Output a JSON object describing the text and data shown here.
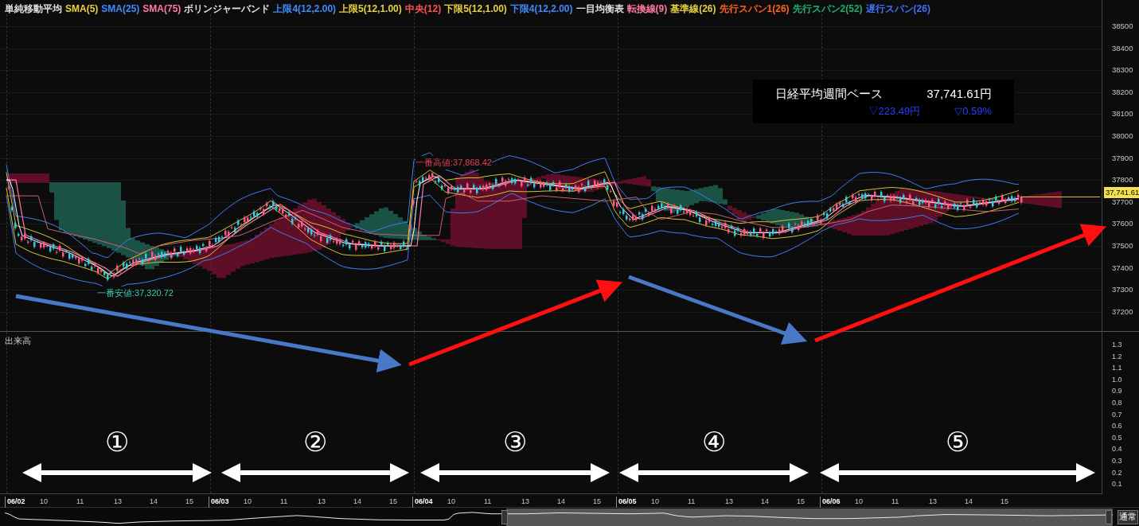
{
  "legend": [
    {
      "text": "単純移動平均",
      "color": "#e0e0e0"
    },
    {
      "text": "SMA(5)",
      "color": "#e8d040"
    },
    {
      "text": "SMA(25)",
      "color": "#3d8cff"
    },
    {
      "text": "SMA(75)",
      "color": "#ff7aa0"
    },
    {
      "text": "ボリンジャーバンド",
      "color": "#e0e0e0"
    },
    {
      "text": "上限4(12,2.00)",
      "color": "#3d8cff"
    },
    {
      "text": "上限5(12,1.00)",
      "color": "#e8d040"
    },
    {
      "text": "中央(12)",
      "color": "#ff5050"
    },
    {
      "text": "下限5(12,1.00)",
      "color": "#e8d040"
    },
    {
      "text": "下限4(12,2.00)",
      "color": "#3d8cff"
    },
    {
      "text": "一目均衡表",
      "color": "#e0e0e0"
    },
    {
      "text": "転換線(9)",
      "color": "#ff7aa0"
    },
    {
      "text": "基準線(26)",
      "color": "#e8d040"
    },
    {
      "text": "先行スパン1(26)",
      "color": "#ff6020"
    },
    {
      "text": "先行スパン2(52)",
      "color": "#20b070"
    },
    {
      "text": "遅行スパン(26)",
      "color": "#4070ff"
    }
  ],
  "info_box": {
    "title": "日経平均週間ベース",
    "price": "37,741.61円",
    "change": "▽223.49円",
    "change_pct": "▽0.59%"
  },
  "markers": [
    {
      "kind": "high",
      "text": "一番高値:37,868.42"
    },
    {
      "kind": "low",
      "text": "一番安値:37,320.72"
    }
  ],
  "price_axis": {
    "ticks": [
      "38500",
      "38400",
      "38300",
      "38200",
      "38100",
      "38000",
      "37900",
      "37800",
      "37700",
      "37600",
      "37500",
      "37400",
      "37300",
      "37200"
    ],
    "current": "37,741.61"
  },
  "volume_pane": {
    "title": "出来高",
    "ticks": [
      "1.3",
      "1.2",
      "1.1",
      "1.0",
      "0.9",
      "0.8",
      "0.7",
      "0.6",
      "0.5",
      "0.4",
      "0.3",
      "0.2",
      "0.1"
    ]
  },
  "sections": [
    {
      "label": "①"
    },
    {
      "label": "②"
    },
    {
      "label": "③"
    },
    {
      "label": "④"
    },
    {
      "label": "⑤"
    }
  ],
  "time_axis": [
    {
      "kind": "date",
      "text": "06/02"
    },
    {
      "kind": "hour",
      "text": "10"
    },
    {
      "kind": "hour",
      "text": "11"
    },
    {
      "kind": "hour",
      "text": "13"
    },
    {
      "kind": "hour",
      "text": "14"
    },
    {
      "kind": "hour",
      "text": "15"
    },
    {
      "kind": "date",
      "text": "06/03"
    },
    {
      "kind": "hour",
      "text": "10"
    },
    {
      "kind": "hour",
      "text": "11"
    },
    {
      "kind": "hour",
      "text": "13"
    },
    {
      "kind": "hour",
      "text": "14"
    },
    {
      "kind": "hour",
      "text": "15"
    },
    {
      "kind": "date",
      "text": "06/04"
    },
    {
      "kind": "hour",
      "text": "10"
    },
    {
      "kind": "hour",
      "text": "11"
    },
    {
      "kind": "hour",
      "text": "13"
    },
    {
      "kind": "hour",
      "text": "14"
    },
    {
      "kind": "hour",
      "text": "15"
    },
    {
      "kind": "date",
      "text": "06/05"
    },
    {
      "kind": "hour",
      "text": "10"
    },
    {
      "kind": "hour",
      "text": "11"
    },
    {
      "kind": "hour",
      "text": "13"
    },
    {
      "kind": "hour",
      "text": "14"
    },
    {
      "kind": "hour",
      "text": "15"
    },
    {
      "kind": "date",
      "text": "06/06"
    },
    {
      "kind": "hour",
      "text": "10"
    },
    {
      "kind": "hour",
      "text": "11"
    },
    {
      "kind": "hour",
      "text": "13"
    },
    {
      "kind": "hour",
      "text": "14"
    },
    {
      "kind": "hour",
      "text": "15"
    }
  ],
  "navigator": {
    "mode": "通常"
  }
}
